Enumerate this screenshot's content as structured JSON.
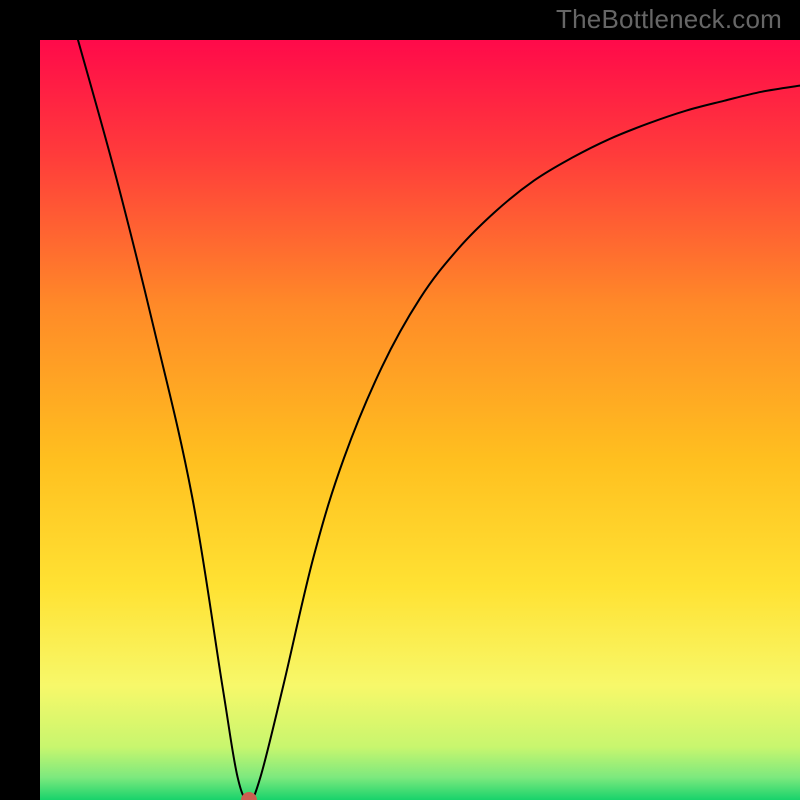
{
  "watermark": "TheBottleneck.com",
  "chart_data": {
    "type": "line",
    "title": "",
    "xlabel": "",
    "ylabel": "",
    "xlim": [
      0,
      100
    ],
    "ylim": [
      0,
      100
    ],
    "grid": false,
    "legend_position": "none",
    "series": [
      {
        "name": "bottleneck-curve",
        "x": [
          5,
          10,
          15,
          20,
          24,
          26,
          27.5,
          29,
          32,
          36,
          40,
          45,
          50,
          55,
          60,
          65,
          70,
          75,
          80,
          85,
          90,
          95,
          100
        ],
        "values": [
          100,
          82,
          62,
          40,
          15,
          3,
          0,
          3,
          15,
          32,
          45,
          57,
          66,
          72.5,
          77.5,
          81.5,
          84.5,
          87,
          89,
          90.7,
          92,
          93.2,
          94
        ]
      }
    ],
    "marker": {
      "x": 27.5,
      "y": 0,
      "color": "#cb5f51"
    },
    "background_gradient": {
      "type": "vertical",
      "stops": [
        {
          "pos": 0.0,
          "color": "#ff0a4a"
        },
        {
          "pos": 0.15,
          "color": "#ff3b3b"
        },
        {
          "pos": 0.35,
          "color": "#ff8a28"
        },
        {
          "pos": 0.55,
          "color": "#ffbf1f"
        },
        {
          "pos": 0.72,
          "color": "#ffe233"
        },
        {
          "pos": 0.85,
          "color": "#f7f86a"
        },
        {
          "pos": 0.93,
          "color": "#c8f66e"
        },
        {
          "pos": 0.97,
          "color": "#7de97e"
        },
        {
          "pos": 1.0,
          "color": "#18d36b"
        }
      ]
    }
  }
}
